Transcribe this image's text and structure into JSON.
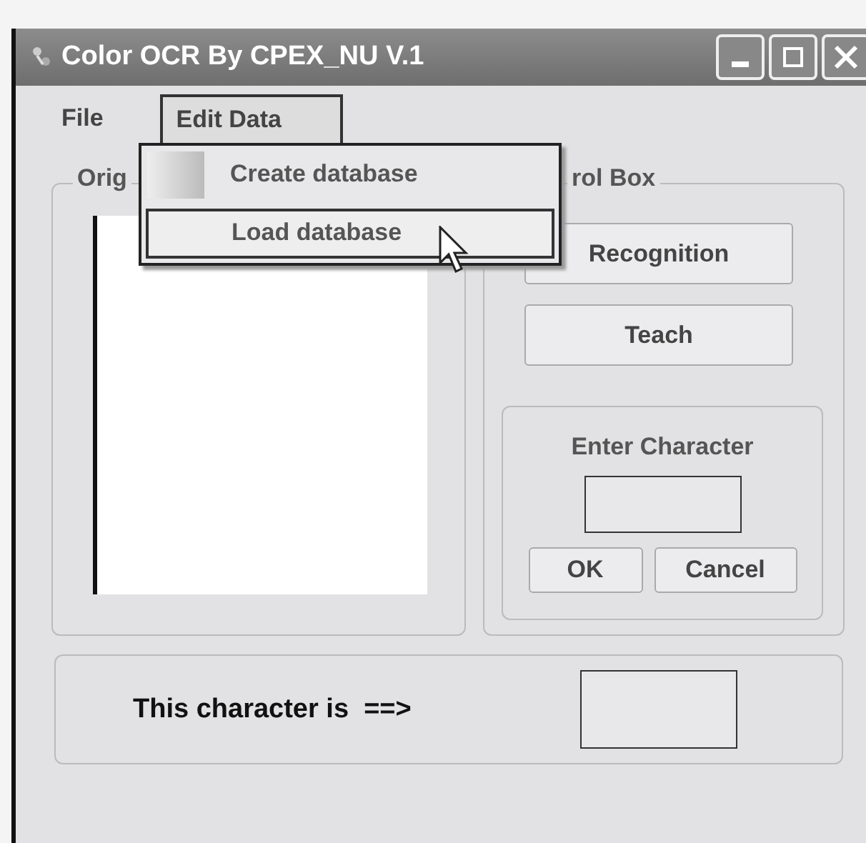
{
  "window": {
    "title": "Color OCR By CPEX_NU V.1"
  },
  "menu_bar": [
    {
      "label": "File",
      "selected": false
    },
    {
      "label": "Edit Data",
      "selected": true
    }
  ],
  "dropdown": [
    {
      "label": "Create database",
      "selected": false
    },
    {
      "label": "Load database",
      "selected": true
    }
  ],
  "original_group": {
    "label": "Orig"
  },
  "control_box": {
    "label": "rol Box",
    "buttons": [
      "Recognition",
      "Teach"
    ],
    "enter_character": {
      "label": "Enter Character",
      "buttons": [
        "OK",
        "Cancel"
      ]
    }
  },
  "result": {
    "label": "This character is  ==>"
  }
}
